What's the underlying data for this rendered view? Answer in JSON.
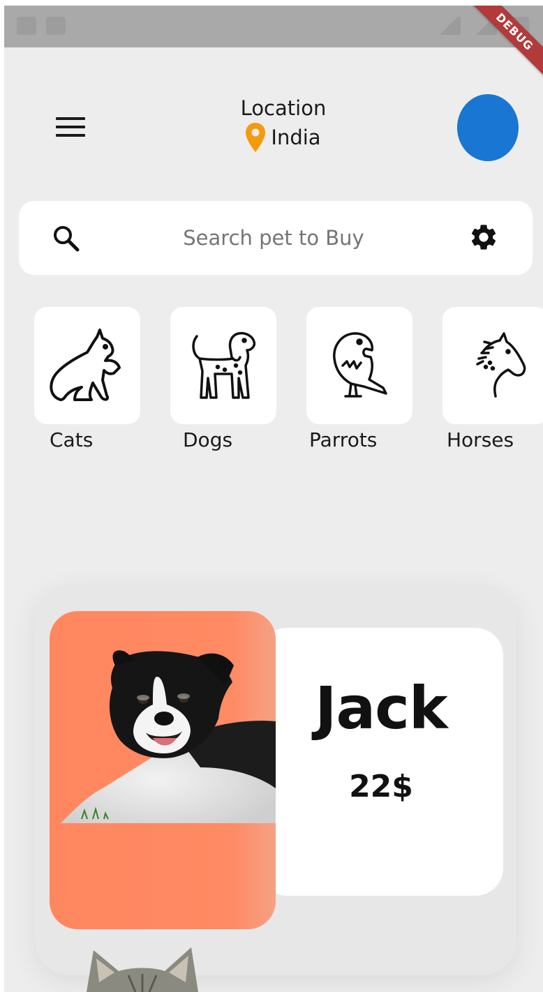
{
  "debug_banner": "DEBUG",
  "header": {
    "location_label": "Location",
    "location_value": "India"
  },
  "search": {
    "placeholder": "Search pet to Buy"
  },
  "categories": [
    {
      "label": "Cats",
      "icon": "cat-icon"
    },
    {
      "label": "Dogs",
      "icon": "dog-icon"
    },
    {
      "label": "Parrots",
      "icon": "parrot-icon"
    },
    {
      "label": "Horses",
      "icon": "horse-icon"
    }
  ],
  "pet_card": {
    "name": "Jack",
    "price": "22$"
  },
  "colors": {
    "avatar": "#1976d2",
    "pin": "#f59a0c",
    "card_photo_bg": "#ff8760",
    "debug_ribbon": "#b23a3a"
  }
}
